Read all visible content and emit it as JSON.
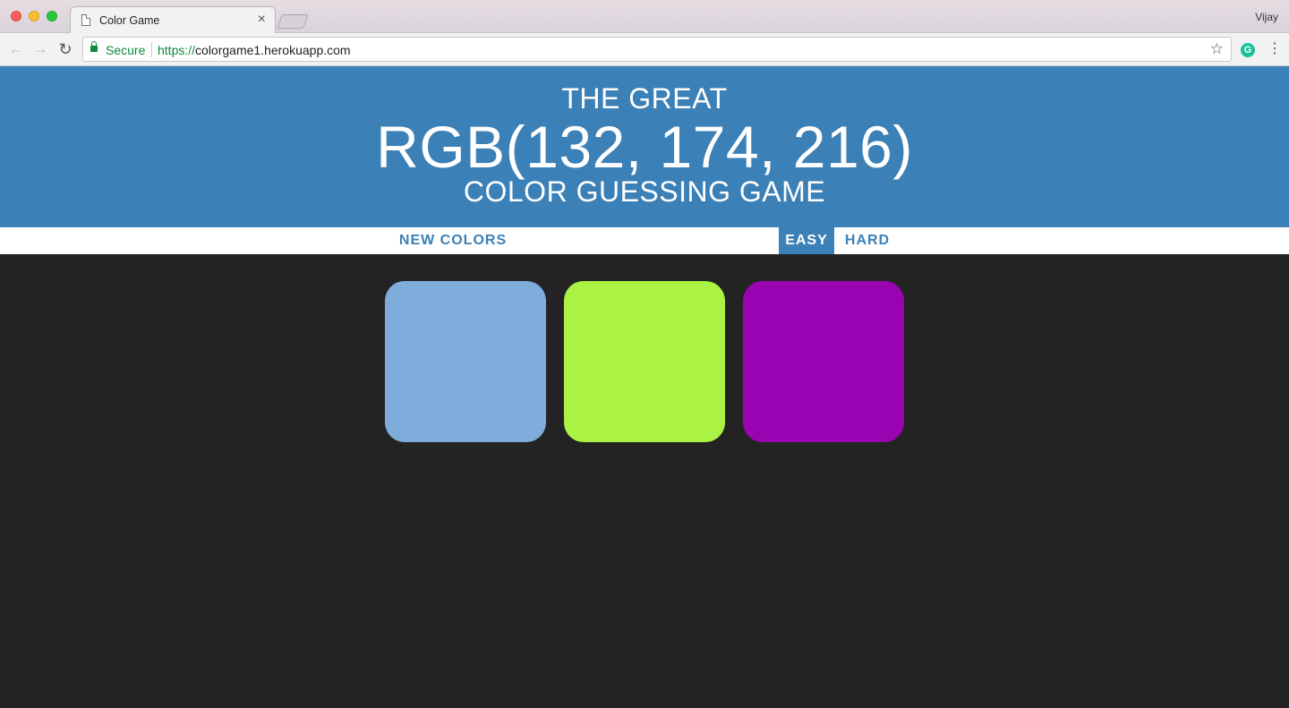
{
  "browser": {
    "tab_title": "Color Game",
    "user_name": "Vijay",
    "secure_label": "Secure",
    "url_scheme": "https://",
    "url_host": "colorgame1.herokuapp.com",
    "extension_icon_letter": "G"
  },
  "header": {
    "line1": "THE GREAT",
    "rgb": "RGB(132, 174, 216)",
    "line3": "COLOR GUESSING GAME"
  },
  "controls": {
    "new_colors": "NEW COLORS",
    "message": "",
    "easy": "EASY",
    "hard": "HARD",
    "active_mode": "easy"
  },
  "squares": [
    {
      "color": "#7eacdb"
    },
    {
      "color": "#aaf244"
    },
    {
      "color": "#9a03b2"
    }
  ],
  "colors": {
    "header_bg": "#3b80b6",
    "page_bg": "#232323",
    "stripe_bg": "#ffffff"
  }
}
